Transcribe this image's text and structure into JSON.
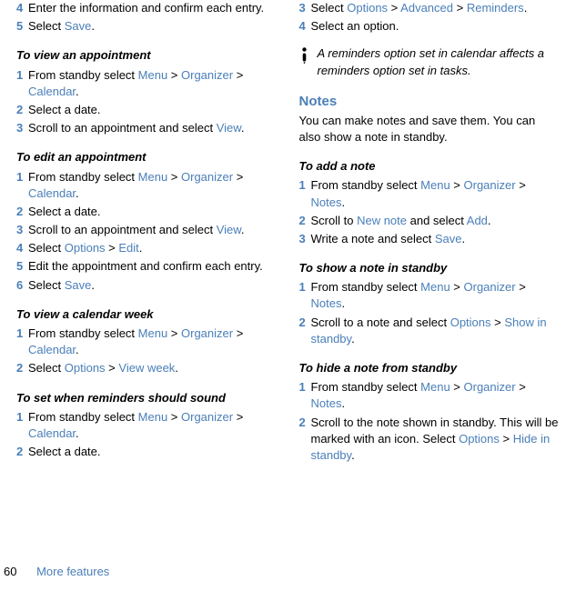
{
  "col1": {
    "s4": "Enter the information and confirm each entry.",
    "s5a": "Select ",
    "s5b": "Save",
    "s5c": ".",
    "h_view_appt": "To view an appointment",
    "va1a": "From standby select ",
    "va1m1": "Menu",
    "va1g1": " > ",
    "va1m2": "Organizer",
    "va1g2": " > ",
    "va1m3": "Calendar",
    "va1c": ".",
    "va2": "Select a date.",
    "va3a": "Scroll to an appointment and select ",
    "va3m": "View",
    "va3c": ".",
    "h_edit_appt": "To edit an appointment",
    "ea1a": "From standby select ",
    "ea1m1": "Menu",
    "ea1g1": " > ",
    "ea1m2": "Organizer",
    "ea1g2": " > ",
    "ea1m3": "Calendar",
    "ea1c": ".",
    "ea2": "Select a date.",
    "ea3a": "Scroll to an appointment and select ",
    "ea3m": "View",
    "ea3c": ".",
    "ea4a": "Select ",
    "ea4m1": "Options",
    "ea4g": " > ",
    "ea4m2": "Edit",
    "ea4c": ".",
    "ea5": "Edit the appointment and confirm each entry.",
    "ea6a": "Select ",
    "ea6m": "Save",
    "ea6c": ".",
    "h_cal_week": "To view a calendar week",
    "cw1a": "From standby select ",
    "cw1m1": "Menu",
    "cw1g1": " > ",
    "cw1m2": "Organizer",
    "cw1g2": " > ",
    "cw1m3": "Calendar",
    "cw1c": ".",
    "cw2a": "Select ",
    "cw2m1": "Options",
    "cw2g": " > ",
    "cw2m2": "View week",
    "cw2c": ".",
    "h_reminders": "To set when reminders should sound",
    "rm1a": "From standby select ",
    "rm1m1": "Menu",
    "rm1g1": " > ",
    "rm1m2": "Organizer",
    "rm1g2": " > ",
    "rm1m3": "Calendar",
    "rm1c": ".",
    "rm2": "Select a date."
  },
  "col2": {
    "r3a": "Select ",
    "r3m1": "Options",
    "r3g1": " > ",
    "r3m2": "Advanced",
    "r3g2": " > ",
    "r3m3": "Reminders",
    "r3c": ".",
    "r4": "Select an option.",
    "note": "A reminders option set in calendar affects a reminders option set in tasks.",
    "h_notes": "Notes",
    "notes_body": "You can make notes and save them. You can also show a note in standby.",
    "h_add_note": "To add a note",
    "an1a": "From standby select ",
    "an1m1": "Menu",
    "an1g1": " > ",
    "an1m2": "Organizer",
    "an1g2": " > ",
    "an1m3": "Notes",
    "an1c": ".",
    "an2a": "Scroll to ",
    "an2m1": "New note",
    "an2b": " and select ",
    "an2m2": "Add",
    "an2c": ".",
    "an3a": "Write a note and select ",
    "an3m": "Save",
    "an3c": ".",
    "h_show_note": "To show a note in standby",
    "sn1a": "From standby select ",
    "sn1m1": "Menu",
    "sn1g1": " > ",
    "sn1m2": "Organizer",
    "sn1g2": " > ",
    "sn1m3": "Notes",
    "sn1c": ".",
    "sn2a": "Scroll to a note and select ",
    "sn2m1": "Options",
    "sn2g": " > ",
    "sn2m2": "Show in standby",
    "sn2c": ".",
    "h_hide_note": "To hide a note from standby",
    "hn1a": "From standby select ",
    "hn1m1": "Menu",
    "hn1g1": " > ",
    "hn1m2": "Organizer",
    "hn1g2": " > ",
    "hn1m3": "Notes",
    "hn1c": ".",
    "hn2a": "Scroll to the note shown in standby. This will be marked with an icon. Select ",
    "hn2m1": "Options",
    "hn2g": " > ",
    "hn2m2": "Hide in standby",
    "hn2c": "."
  },
  "nums": {
    "n1": "1",
    "n2": "2",
    "n3": "3",
    "n4": "4",
    "n5": "5",
    "n6": "6"
  },
  "footer": {
    "page": "60",
    "text": "More features"
  }
}
